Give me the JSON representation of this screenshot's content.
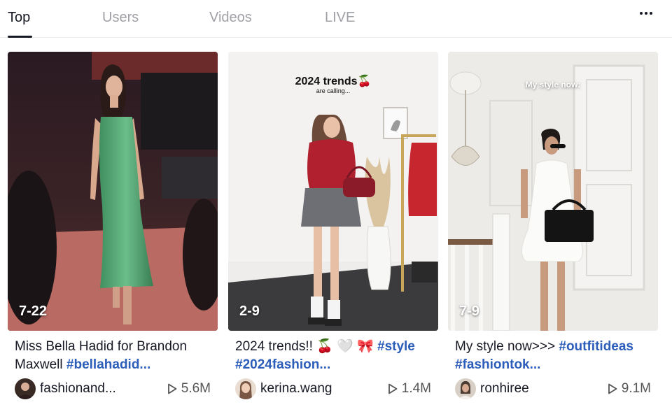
{
  "tabs": [
    {
      "label": "Top",
      "active": true
    },
    {
      "label": "Users",
      "active": false
    },
    {
      "label": "Videos",
      "active": false
    },
    {
      "label": "LIVE",
      "active": false
    }
  ],
  "more_icon": "more-horizontal-icon",
  "videos": [
    {
      "date": "7-22",
      "overlay_text": "",
      "overlay_sub": "",
      "desc_text": "Miss Bella Hadid for Brandon Maxwell ",
      "desc_tags": "#bellahadid...",
      "author": "fashionand...",
      "views": "5.6M"
    },
    {
      "date": "2-9",
      "overlay_text": "2024 trends🍒",
      "overlay_sub": "are calling...",
      "desc_text": "2024 trends!! 🍒 🤍 🎀 ",
      "desc_tags": "#style #2024fashion...",
      "author": "kerina.wang",
      "views": "1.4M"
    },
    {
      "date": "7-9",
      "overlay_text": "My style now:",
      "overlay_sub": "",
      "desc_text": "My style now>>> ",
      "desc_tags": "#outfitideas #fashiontok...",
      "author": "ronhiree",
      "views": "9.1M"
    }
  ],
  "colors": {
    "hashtag": "#2b5db9",
    "tab_inactive": "#a0a1a7",
    "text": "#161823"
  }
}
